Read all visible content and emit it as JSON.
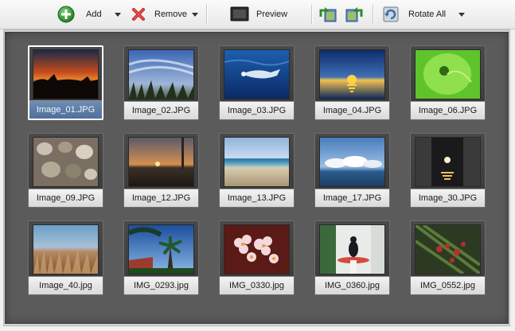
{
  "toolbar": {
    "add_label": "Add",
    "remove_label": "Remove",
    "preview_label": "Preview",
    "rotate_all_label": "Rotate All"
  },
  "images": [
    {
      "name": "Image_01.JPG",
      "selected": true
    },
    {
      "name": "Image_02.JPG",
      "selected": false
    },
    {
      "name": "Image_03.JPG",
      "selected": false
    },
    {
      "name": "Image_04.JPG",
      "selected": false
    },
    {
      "name": "Image_06.JPG",
      "selected": false
    },
    {
      "name": "Image_09.JPG",
      "selected": false
    },
    {
      "name": "Image_12.JPG",
      "selected": false
    },
    {
      "name": "Image_13.JPG",
      "selected": false
    },
    {
      "name": "Image_17.JPG",
      "selected": false
    },
    {
      "name": "Image_30.JPG",
      "selected": false
    },
    {
      "name": "Image_40.jpg",
      "selected": false
    },
    {
      "name": "IMG_0293.jpg",
      "selected": false
    },
    {
      "name": "IMG_0330.jpg",
      "selected": false
    },
    {
      "name": "IMG_0360.jpg",
      "selected": false
    },
    {
      "name": "IMG_0552.jpg",
      "selected": false
    }
  ],
  "colors": {
    "gallery_background": "#5b5b5b",
    "selected_caption": "#5a7aa6",
    "add_icon": "#2f9a2f",
    "remove_icon": "#c62828"
  }
}
